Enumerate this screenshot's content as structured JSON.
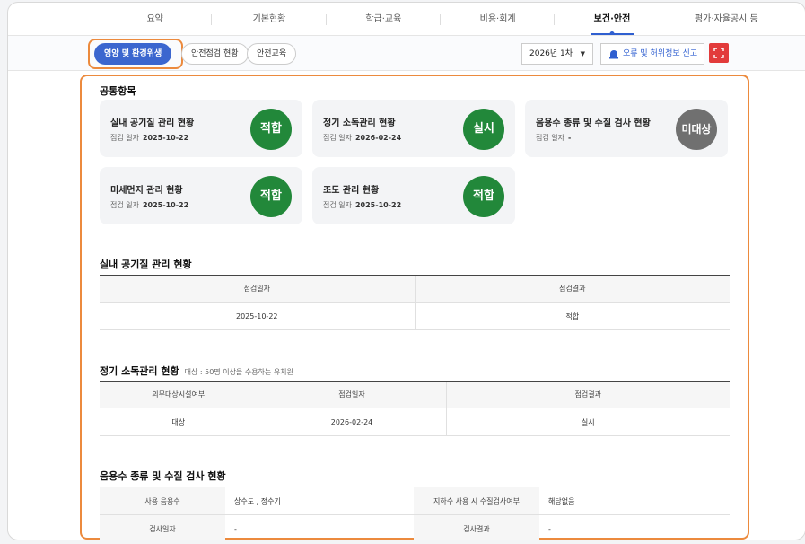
{
  "top_tabs": [
    "요약",
    "기본현황",
    "학급·교육",
    "비용·회계",
    "보건·안전",
    "평가·자율공시 등"
  ],
  "active_top_tab": "보건·안전",
  "sub_tabs": [
    "영양 및 환경위생",
    "안전점검 현황",
    "안전교육"
  ],
  "active_sub_tab": "영양 및 환경위생",
  "term_select": {
    "value": "2026년 1차"
  },
  "report_button": {
    "label": "오류 및 허위정보 신고",
    "icon": "siren-icon"
  },
  "expand_button": {
    "icon": "expand-icon"
  },
  "colors": {
    "accent": "#3b66cf",
    "badge_green": "#22883a",
    "badge_gray": "#707070",
    "highlight": "#ec8a3d",
    "expand_red": "#e23b3b"
  },
  "common": {
    "title": "공통항목",
    "cards": [
      {
        "title": "실내 공기질 관리 현황",
        "date_label": "점검 일자",
        "date": "2025-10-22",
        "badge": "적합",
        "badge_color": "green"
      },
      {
        "title": "정기 소독관리 현황",
        "date_label": "점검 일자",
        "date": "2026-02-24",
        "badge": "실시",
        "badge_color": "green"
      },
      {
        "title": "음용수 종류 및 수질 검사 현황",
        "date_label": "점검 일자",
        "date": "-",
        "badge": "미대상",
        "badge_color": "gray"
      },
      {
        "title": "미세먼지 관리 현황",
        "date_label": "점검 일자",
        "date": "2025-10-22",
        "badge": "적합",
        "badge_color": "green"
      },
      {
        "title": "조도 관리 현황",
        "date_label": "점검 일자",
        "date": "2025-10-22",
        "badge": "적합",
        "badge_color": "green"
      }
    ]
  },
  "air": {
    "title": "실내 공기질 관리 현황",
    "headers": [
      "점검일자",
      "점검결과"
    ],
    "row": [
      "2025-10-22",
      "적합"
    ]
  },
  "disinfect": {
    "title": "정기 소독관리 현황",
    "note": "대상 : 50명 이상을 수용하는 유치원",
    "headers": [
      "의무대상시설여부",
      "점검일자",
      "점검결과"
    ],
    "row": [
      "대상",
      "2026-02-24",
      "실시"
    ]
  },
  "water": {
    "title": "음용수 종류 및 수질 검사 현황",
    "rows": [
      {
        "k1": "사용 음용수",
        "v1": "상수도 , 정수기",
        "k2": "지하수 사용 시 수질검사여부",
        "v2": "해당없음"
      },
      {
        "k1": "검사일자",
        "v1": "-",
        "k2": "검사결과",
        "v2": "-"
      }
    ]
  }
}
